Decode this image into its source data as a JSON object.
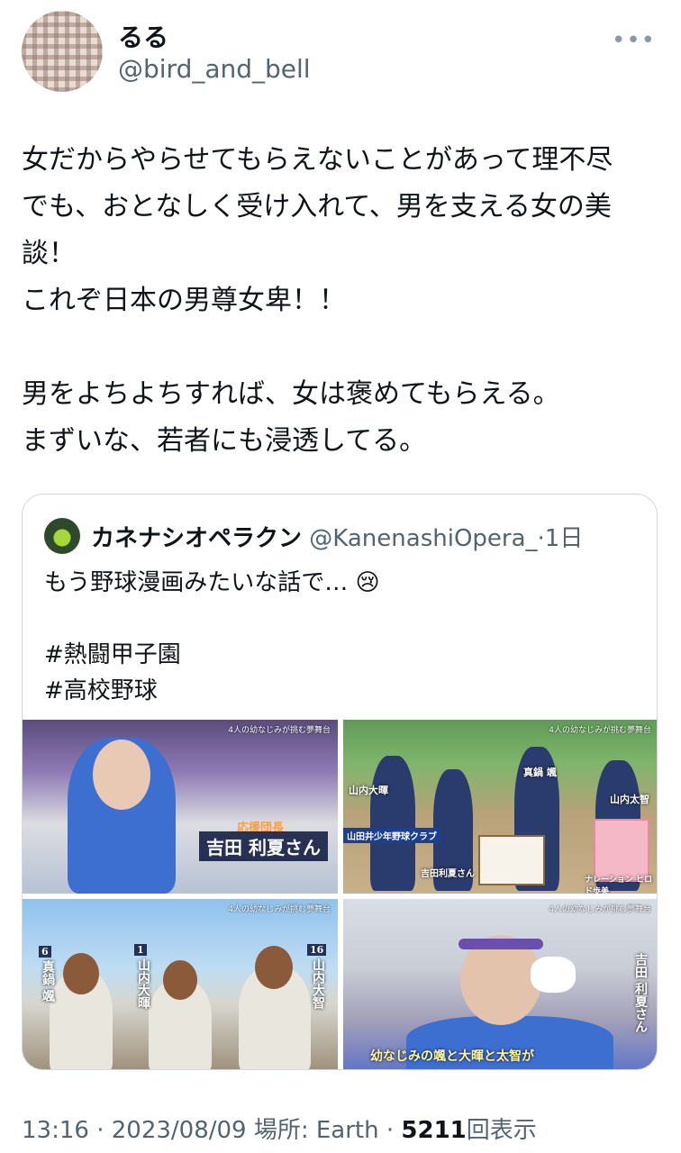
{
  "author": {
    "display_name": "るる",
    "handle": "@bird_and_bell",
    "more_icon": "more-horizontal-icon"
  },
  "tweet": {
    "text": "女だからやらせてもらえないことがあって理不尽\nでも、おとなしく受け入れて、男を支える女の美\n談！\nこれぞ日本の男尊女卑！！\n\n男をよちよちすれば、女は褒めてもらえる。\nまずいな、若者にも浸透してる。"
  },
  "quote": {
    "display_name": "カネナシオペラクン",
    "handle": "@KanenashiOpera_",
    "separator": "·",
    "age": "1日",
    "text": "もう野球漫画みたいな話で… 😢\n\n#熱闘甲子園\n#高校野球",
    "media": [
      {
        "top_caption": "4人の幼なじみが挑む夢舞台",
        "title": "応援団長",
        "name": "吉田 利夏さん"
      },
      {
        "top_caption": "4人の幼なじみが挑む夢舞台",
        "label1": "山内大暉",
        "label2": "真鍋 颯",
        "label3": "山内太智",
        "label4": "吉田利夏さん",
        "banner": "山田井少年野球クラブ",
        "narration": "ナレーション ヒロド歩美"
      },
      {
        "top_caption": "4人の幼なじみが挑む夢舞台",
        "num1": "6",
        "name1": "真鍋 颯",
        "num2": "1",
        "name2": "山内大暉",
        "num3": "16",
        "name3": "山内大智"
      },
      {
        "top_caption": "4人の幼なじみが挑む夢舞台",
        "side_name": "吉田 利夏さん",
        "subtitle1": "幼なじみの颯と大暉と太智が"
      }
    ]
  },
  "footer": {
    "time": "13:16",
    "dot1": "·",
    "date": "2023/08/09",
    "location_label": "場所: Earth",
    "dot2": "·",
    "views": "5211",
    "views_label": "回表示"
  }
}
